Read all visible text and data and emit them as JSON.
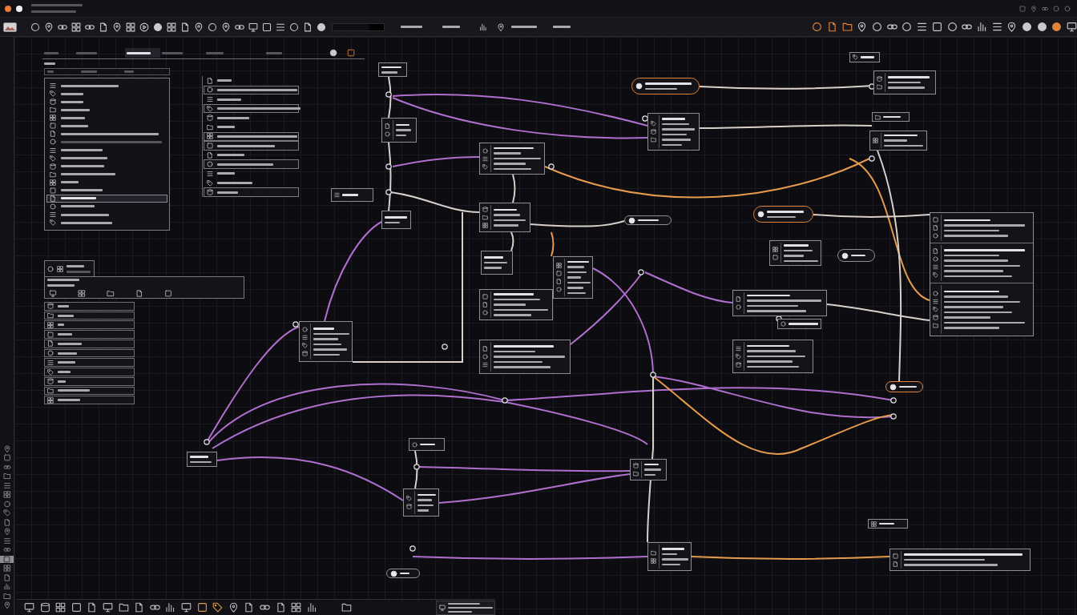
{
  "window": {
    "dots": [
      {
        "color": "#f07a3a"
      },
      {
        "color": "#f2f2f2"
      }
    ]
  },
  "toolbar": {
    "tools": [
      {
        "active": false
      },
      {
        "active": false
      },
      {
        "active": false
      },
      {
        "active": false
      },
      {
        "active": false
      },
      {
        "active": false
      },
      {
        "active": false
      },
      {
        "active": false
      },
      {
        "active": false
      },
      {
        "active": false
      },
      {
        "active": false
      },
      {
        "active": false
      },
      {
        "active": false
      },
      {
        "active": false
      },
      {
        "active": false
      },
      {
        "active": false
      },
      {
        "active": false
      },
      {
        "active": false
      },
      {
        "active": false
      },
      {
        "active": false
      },
      {
        "active": false
      },
      {
        "active": false
      }
    ],
    "right_tools": [
      {
        "active": true
      },
      {
        "active": true
      },
      {
        "active": true
      },
      {
        "active": false
      },
      {
        "active": false
      },
      {
        "active": false
      },
      {
        "active": false
      },
      {
        "active": false
      },
      {
        "active": false
      },
      {
        "active": false
      },
      {
        "active": false
      },
      {
        "active": false
      },
      {
        "active": false
      },
      {
        "active": false
      },
      {
        "active": false
      },
      {
        "active": false
      },
      {
        "active": true
      },
      {
        "active": false
      }
    ]
  },
  "side_strip": {
    "items": [
      {
        "selected": false
      },
      {
        "selected": false
      },
      {
        "selected": false
      },
      {
        "selected": false
      },
      {
        "selected": false
      },
      {
        "selected": false
      },
      {
        "selected": false
      },
      {
        "selected": false
      },
      {
        "selected": false
      },
      {
        "selected": false
      },
      {
        "selected": false
      },
      {
        "selected": false
      },
      {
        "selected": true
      },
      {
        "selected": false
      },
      {
        "selected": false
      },
      {
        "selected": false
      },
      {
        "selected": false
      },
      {
        "selected": false
      }
    ]
  },
  "library_panel": {
    "tabs": [
      {
        "selected": false
      },
      {
        "selected": false
      },
      {
        "selected": true
      },
      {
        "selected": false
      },
      {
        "selected": false
      },
      {
        "selected": false
      }
    ],
    "header_tools": [
      {
        "active": false
      },
      {
        "active": true
      }
    ],
    "items": [
      {
        "selected": false,
        "disabled": false
      },
      {
        "selected": false,
        "disabled": false
      },
      {
        "selected": false,
        "disabled": false
      },
      {
        "selected": false,
        "disabled": false
      },
      {
        "selected": false,
        "disabled": false
      },
      {
        "selected": false,
        "disabled": false
      },
      {
        "selected": false,
        "disabled": false
      },
      {
        "selected": false,
        "disabled": true
      },
      {
        "selected": false,
        "disabled": false
      },
      {
        "selected": false,
        "disabled": false
      },
      {
        "selected": false,
        "disabled": false
      },
      {
        "selected": false,
        "disabled": false
      },
      {
        "selected": false,
        "disabled": false
      },
      {
        "selected": false,
        "disabled": false
      },
      {
        "selected": true,
        "disabled": false
      },
      {
        "selected": false,
        "disabled": false
      },
      {
        "selected": false,
        "disabled": false
      },
      {
        "selected": false,
        "disabled": false
      }
    ]
  },
  "layer_panel": {
    "rows": [
      {
        "kind": "plain"
      },
      {
        "kind": "framed"
      },
      {
        "kind": "plain"
      },
      {
        "kind": "framed"
      },
      {
        "kind": "plain"
      },
      {
        "kind": "plain"
      },
      {
        "kind": "framed"
      },
      {
        "kind": "framed"
      },
      {
        "kind": "plain"
      },
      {
        "kind": "framed"
      },
      {
        "kind": "plain"
      },
      {
        "kind": "plain"
      },
      {
        "kind": "framed"
      }
    ]
  },
  "graph": {
    "nodes": [
      {
        "kind": "card",
        "highlighted": false
      },
      {
        "kind": "card",
        "highlighted": false
      },
      {
        "kind": "card",
        "highlighted": false
      },
      {
        "kind": "card",
        "highlighted": false
      },
      {
        "kind": "card",
        "highlighted": false
      },
      {
        "kind": "card",
        "highlighted": false
      },
      {
        "kind": "card",
        "highlighted": false
      },
      {
        "kind": "card",
        "highlighted": false
      },
      {
        "kind": "card",
        "highlighted": false
      },
      {
        "kind": "card",
        "highlighted": false
      },
      {
        "kind": "card",
        "highlighted": false
      },
      {
        "kind": "pill",
        "highlighted": true
      },
      {
        "kind": "card",
        "highlighted": false
      },
      {
        "kind": "pill",
        "highlighted": false
      },
      {
        "kind": "pill",
        "highlighted": true
      },
      {
        "kind": "card",
        "highlighted": false
      },
      {
        "kind": "pill",
        "highlighted": false
      },
      {
        "kind": "card",
        "highlighted": false
      },
      {
        "kind": "card",
        "highlighted": false
      },
      {
        "kind": "card",
        "highlighted": false
      },
      {
        "kind": "card",
        "highlighted": false
      },
      {
        "kind": "card",
        "highlighted": false
      },
      {
        "kind": "card",
        "highlighted": false
      },
      {
        "kind": "card",
        "highlighted": false
      },
      {
        "kind": "panel",
        "highlighted": false
      },
      {
        "kind": "pill",
        "highlighted": true
      },
      {
        "kind": "card",
        "highlighted": false
      },
      {
        "kind": "card",
        "highlighted": false
      },
      {
        "kind": "card",
        "highlighted": false
      },
      {
        "kind": "card",
        "highlighted": false
      },
      {
        "kind": "card",
        "highlighted": false
      },
      {
        "kind": "card",
        "highlighted": false
      },
      {
        "kind": "card",
        "highlighted": false
      },
      {
        "kind": "pill",
        "highlighted": false
      }
    ],
    "edges": [
      {
        "color": "#b06fcf"
      },
      {
        "color": "#b06fcf"
      },
      {
        "color": "#b06fcf"
      },
      {
        "color": "#b06fcf"
      },
      {
        "color": "#b06fcf"
      },
      {
        "color": "#b06fcf"
      },
      {
        "color": "#b06fcf"
      },
      {
        "color": "#b06fcf"
      },
      {
        "color": "#b06fcf"
      },
      {
        "color": "#b06fcf"
      },
      {
        "color": "#b06fcf"
      },
      {
        "color": "#b06fcf"
      },
      {
        "color": "#b06fcf"
      },
      {
        "color": "#b06fcf"
      },
      {
        "color": "#b06fcf"
      },
      {
        "color": "#b06fcf"
      },
      {
        "color": "#b06fcf"
      },
      {
        "color": "#e59a4c"
      },
      {
        "color": "#e59a4c"
      },
      {
        "color": "#e59a4c"
      },
      {
        "color": "#e59a4c"
      },
      {
        "color": "#e59a4c"
      },
      {
        "color": "#d7cfc8"
      },
      {
        "color": "#d7cfc8"
      },
      {
        "color": "#d7cfc8"
      },
      {
        "color": "#d7cfc8"
      },
      {
        "color": "#d7cfc8"
      },
      {
        "color": "#d7cfc8"
      },
      {
        "color": "#d7cfc8"
      },
      {
        "color": "#d7cfc8"
      },
      {
        "color": "#d7cfc8"
      },
      {
        "color": "#d7cfc8"
      },
      {
        "color": "#d7cfc8"
      },
      {
        "color": "#d7cfc8"
      },
      {
        "color": "#d7cfc8"
      },
      {
        "color": "#d7cfc8"
      }
    ]
  },
  "bottom_bar": {
    "tools": [
      {
        "active": false
      },
      {
        "active": false
      },
      {
        "active": false
      },
      {
        "active": false
      },
      {
        "active": false
      },
      {
        "active": false
      },
      {
        "active": false
      },
      {
        "active": false
      },
      {
        "active": false
      },
      {
        "active": false
      },
      {
        "active": false
      },
      {
        "active": true
      },
      {
        "active": true
      },
      {
        "active": false
      },
      {
        "active": false
      },
      {
        "active": false
      },
      {
        "active": false
      },
      {
        "active": false
      },
      {
        "active": false
      },
      {
        "active": false
      }
    ]
  }
}
